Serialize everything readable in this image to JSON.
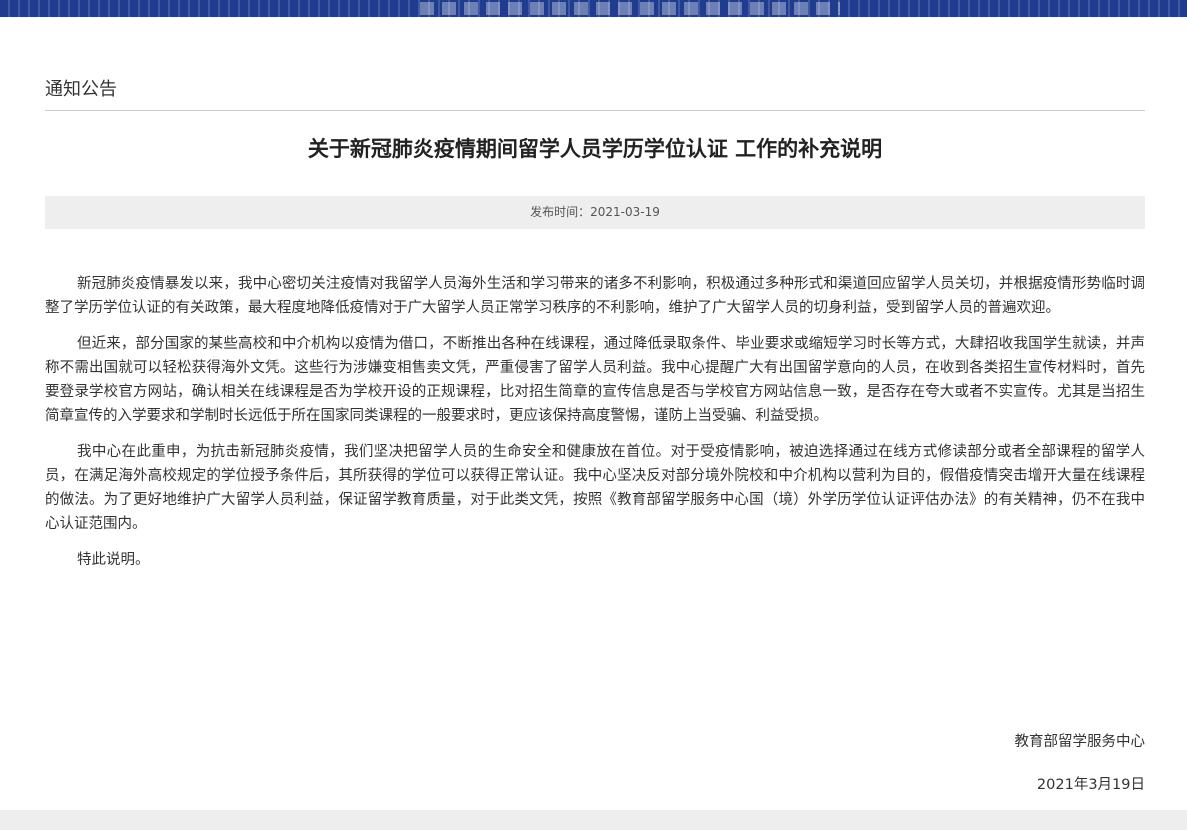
{
  "section": {
    "title": "通知公告"
  },
  "article": {
    "title": "关于新冠肺炎疫情期间留学人员学历学位认证 工作的补充说明",
    "meta": "发布时间：2021-03-19",
    "paragraphs": [
      "新冠肺炎疫情暴发以来，我中心密切关注疫情对我留学人员海外生活和学习带来的诸多不利影响，积极通过多种形式和渠道回应留学人员关切，并根据疫情形势临时调整了学历学位认证的有关政策，最大程度地降低疫情对于广大留学人员正常学习秩序的不利影响，维护了广大留学人员的切身利益，受到留学人员的普遍欢迎。",
      "但近来，部分国家的某些高校和中介机构以疫情为借口，不断推出各种在线课程，通过降低录取条件、毕业要求或缩短学习时长等方式，大肆招收我国学生就读，并声称不需出国就可以轻松获得海外文凭。这些行为涉嫌变相售卖文凭，严重侵害了留学人员利益。我中心提醒广大有出国留学意向的人员，在收到各类招生宣传材料时，首先要登录学校官方网站，确认相关在线课程是否为学校开设的正规课程，比对招生简章的宣传信息是否与学校官方网站信息一致，是否存在夸大或者不实宣传。尤其是当招生简章宣传的入学要求和学制时长远低于所在国家同类课程的一般要求时，更应该保持高度警惕，谨防上当受骗、利益受损。",
      "我中心在此重申，为抗击新冠肺炎疫情，我们坚决把留学人员的生命安全和健康放在首位。对于受疫情影响，被迫选择通过在线方式修读部分或者全部课程的留学人员，在满足海外高校规定的学位授予条件后，其所获得的学位可以获得正常认证。我中心坚决反对部分境外院校和中介机构以营利为目的，假借疫情突击增开大量在线课程的做法。为了更好地维护广大留学人员利益，保证留学教育质量，对于此类文凭，按照《教育部留学服务中心国（境）外学历学位认证评估办法》的有关精神，仍不在我中心认证范围内。",
      "特此说明。"
    ],
    "signature_org": "教育部留学服务中心",
    "signature_date": "2021年3月19日"
  },
  "colors": {
    "banner": "#1f3c8f",
    "meta_bar": "#eeeeee",
    "text": "#333333"
  }
}
